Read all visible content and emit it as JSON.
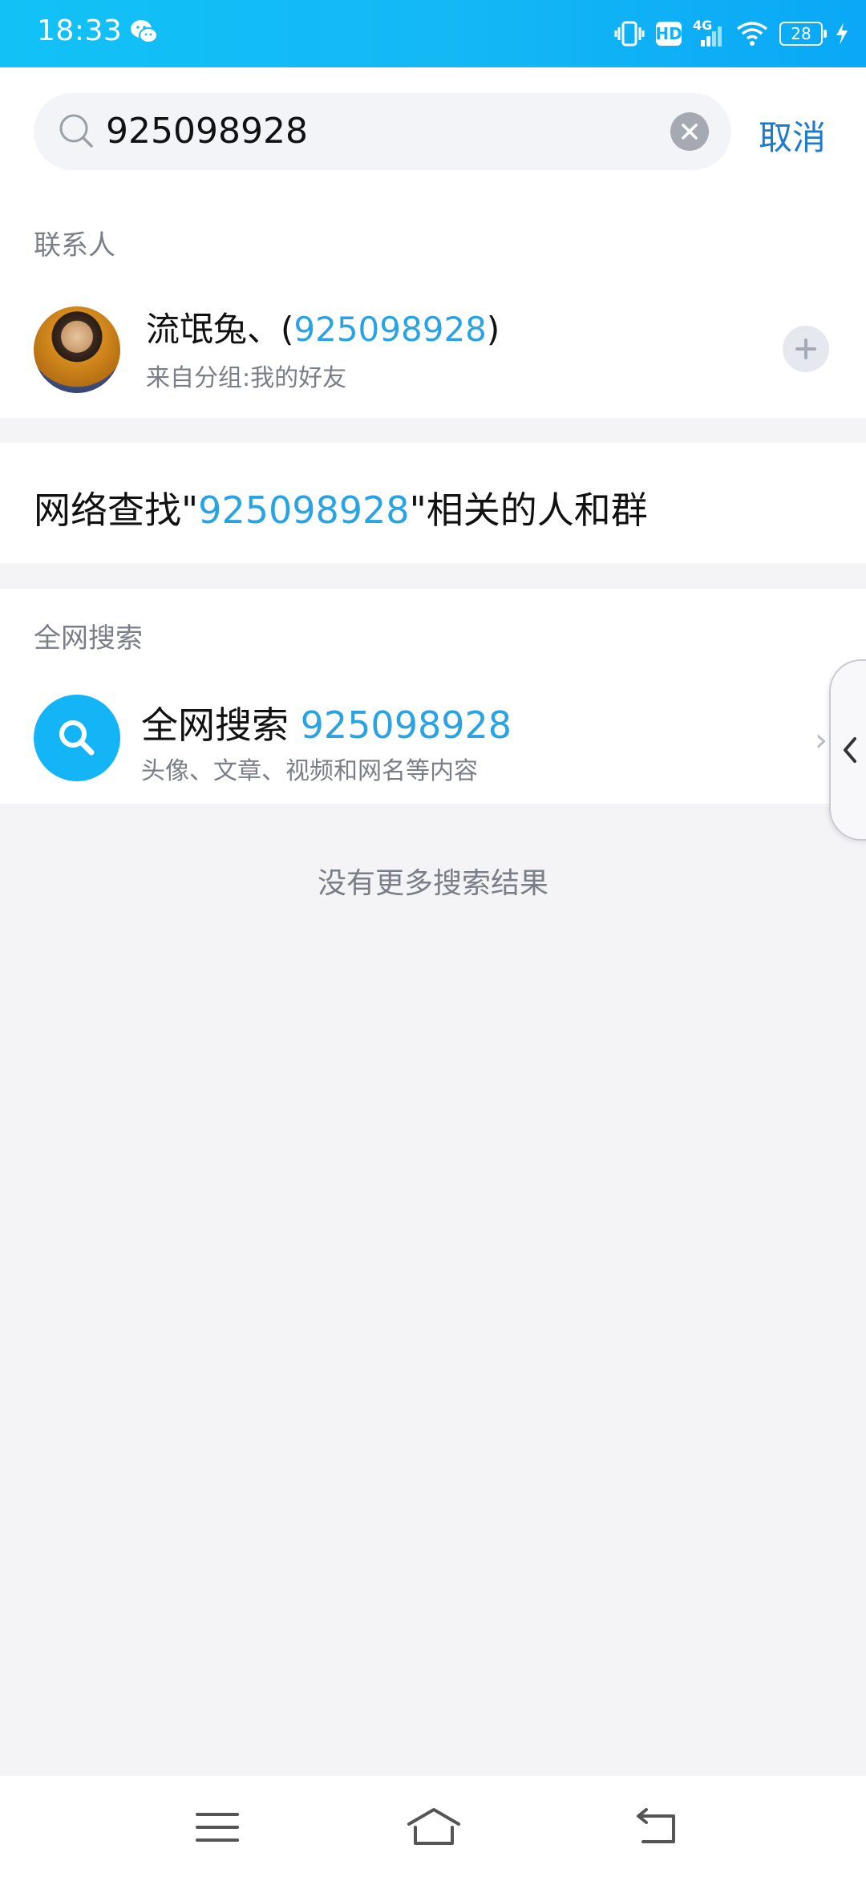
{
  "status_bar": {
    "time": "18:33",
    "hd_label": "HD",
    "network_label": "4G",
    "battery": "28",
    "icons": [
      "wechat-icon",
      "vibrate-icon",
      "signal-icon",
      "wifi-icon",
      "battery-icon",
      "charging-icon"
    ]
  },
  "search": {
    "query": "925098928",
    "cancel_label": "取消"
  },
  "contacts_section": {
    "title": "联系人",
    "items": [
      {
        "name_prefix": "流氓兔、(",
        "name_match": "925098928",
        "name_suffix": ")",
        "subtitle": "来自分组:我的好友"
      }
    ]
  },
  "network_find": {
    "prefix": "网络查找\"",
    "query": "925098928",
    "suffix": "\"相关的人和群"
  },
  "web_search_section": {
    "title": "全网搜索",
    "item_title": "全网搜索 ",
    "item_query": "925098928",
    "item_subtitle": "头像、文章、视频和网名等内容"
  },
  "no_more_results": "没有更多搜索结果",
  "colors": {
    "accent_blue": "#2aa3e3",
    "cancel_blue": "#1e7bd0",
    "status_bar": "#12c2f7",
    "search_icon_bg": "#14b5f6"
  }
}
